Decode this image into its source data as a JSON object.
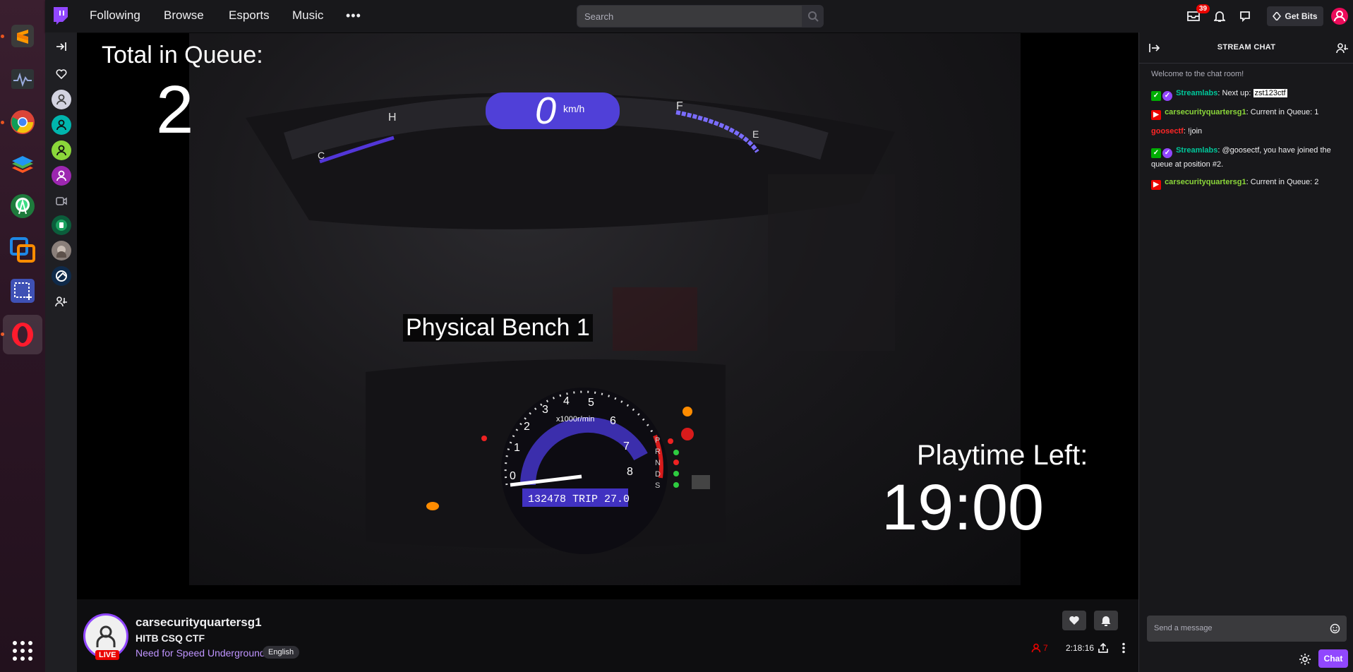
{
  "nav": {
    "links": [
      "Following",
      "Browse",
      "Esports",
      "Music"
    ],
    "more": "•••",
    "search_placeholder": "Search",
    "inbox_count": "39",
    "get_bits": "Get Bits"
  },
  "video": {
    "queue_label": "Total in Queue:",
    "queue_count": "2",
    "bench_label": "Physical Bench 1",
    "playtime_label": "Playtime Left:",
    "playtime_value": "19:00"
  },
  "stream": {
    "channel": "carsecurityquartersg1",
    "title": "HITB CSQ CTF",
    "game": "Need for Speed Underground",
    "tag": "English",
    "live": "LIVE",
    "viewers": "7",
    "uptime": "2:18:16"
  },
  "chat": {
    "header": "STREAM CHAT",
    "welcome": "Welcome to the chat room!",
    "messages": [
      {
        "user": "Streamlabs",
        "sep": ": ",
        "text": "Next up: ",
        "highlight": "zst123ctf"
      },
      {
        "user": "carsecurityquartersg1",
        "sep": ": ",
        "text": "Current in Queue: 1"
      },
      {
        "user": "goosectf",
        "sep": ": ",
        "text": "!join"
      },
      {
        "user": "Streamlabs",
        "sep": ": ",
        "text": "@goosectf, you have joined the queue at position #2."
      },
      {
        "user": "carsecurityquartersg1",
        "sep": ": ",
        "text": "Current in Queue: 2"
      }
    ],
    "input_placeholder": "Send a message",
    "send_label": "Chat"
  },
  "colors": {
    "twitch_purple": "#9147ff",
    "streamlabs_green": "#00c79a",
    "broadcaster_green": "#8bd73a",
    "goose_red": "#ff2626",
    "live_red": "#eb0400"
  }
}
